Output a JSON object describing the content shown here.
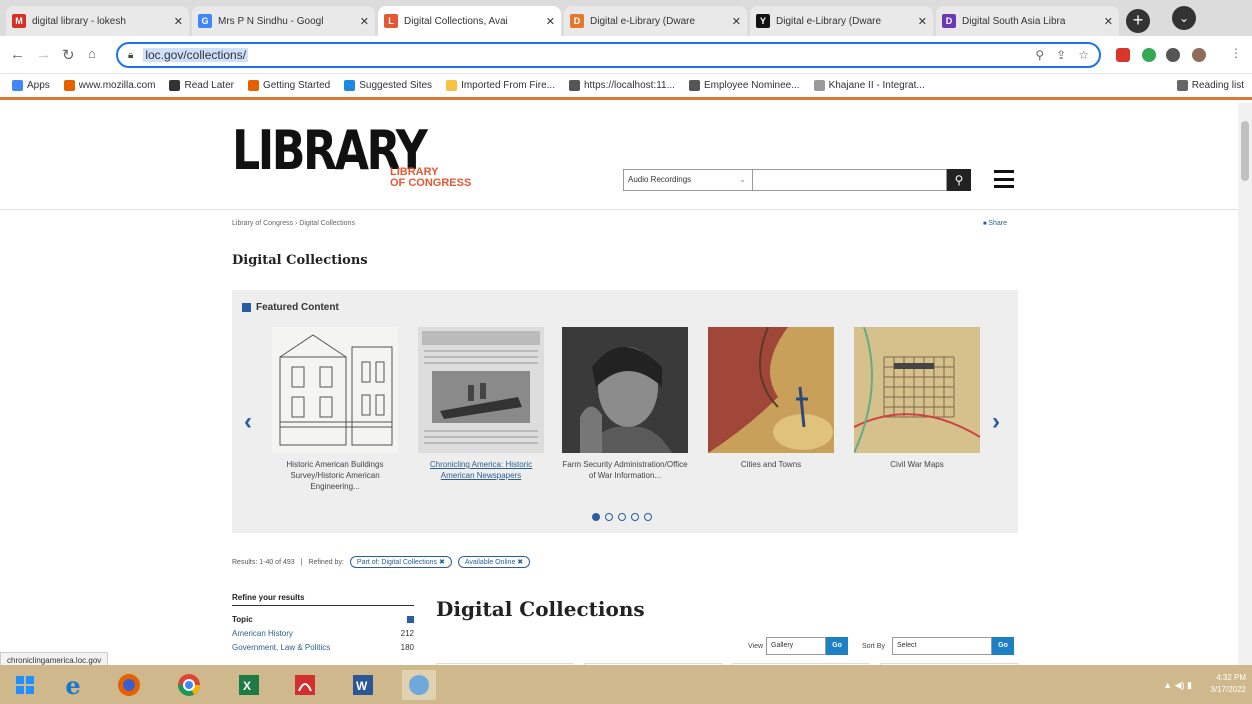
{
  "browser": {
    "tabs": [
      {
        "title": "digital library - lokesh",
        "favicon_color": "#d93025",
        "favicon_glyph": "M"
      },
      {
        "title": "Mrs P N Sindhu - Googl",
        "favicon_color": "#4285f4",
        "favicon_glyph": "G"
      },
      {
        "title": "Digital Collections, Avai",
        "favicon_color": "#e45833",
        "favicon_glyph": "L"
      },
      {
        "title": "Digital e-Library (Dware",
        "favicon_color": "#e4782c",
        "favicon_glyph": "D"
      },
      {
        "title": "Digital e-Library (Dware",
        "favicon_color": "#111111",
        "favicon_glyph": "Y"
      },
      {
        "title": "Digital South Asia Libra",
        "favicon_color": "#6a3ab2",
        "favicon_glyph": "D"
      }
    ],
    "new_tab": "+",
    "tab_menu": "⌄",
    "url": "loc.gov/collections/",
    "bookmarks": [
      {
        "label": "Apps",
        "color": "#4285f4"
      },
      {
        "label": "www.mozilla.com",
        "color": "#e66000"
      },
      {
        "label": "Read Later",
        "color": "#333333"
      },
      {
        "label": "Getting Started",
        "color": "#e66000"
      },
      {
        "label": "Suggested Sites",
        "color": "#1e88e5"
      },
      {
        "label": "Imported From Fire...",
        "color": "#f6c244"
      },
      {
        "label": "https://localhost:11...",
        "color": "#555555"
      },
      {
        "label": "Employee Nominee...",
        "color": "#555555"
      },
      {
        "label": "Khajane II - Integrat...",
        "color": "#999999"
      }
    ],
    "reading_list": "Reading list",
    "status_url": "chroniclingamerica.loc.gov"
  },
  "site": {
    "logo_main": "LIBRARY",
    "logo_sub_1": "LIBRARY",
    "logo_sub_2": "OF CONGRESS",
    "search_select": "Audio Recordings",
    "breadcrumb": "Library of Congress › Digital Collections",
    "share": "Share",
    "page_title": "Digital Collections",
    "featured_heading": "Featured Content",
    "featured": [
      {
        "caption": "Historic American Buildings Survey/Historic American Engineering...",
        "link": false
      },
      {
        "caption": "Chronicling America: Historic American Newspapers",
        "link": true
      },
      {
        "caption": "Farm Security Administration/Office of War Information...",
        "link": false
      },
      {
        "caption": "Cities and Towns",
        "link": false
      },
      {
        "caption": "Civil War Maps",
        "link": false
      }
    ],
    "results_text": "Results: 1-40 of 493",
    "refined_by": "Refined by:",
    "filters": [
      "Part of: Digital Collections ✖",
      "Available Online ✖"
    ],
    "refine_heading": "Refine your results",
    "topic_heading": "Topic",
    "facets": [
      {
        "label": "American History",
        "count": "212"
      },
      {
        "label": "Government, Law & Politics",
        "count": "180"
      }
    ],
    "main_heading": "Digital Collections",
    "view_label": "View",
    "view_value": "Gallery",
    "sort_label": "Sort By",
    "sort_value": "Select",
    "go_label": "Go"
  },
  "taskbar": {
    "time": "4:32 PM",
    "date": "3/17/2022"
  }
}
